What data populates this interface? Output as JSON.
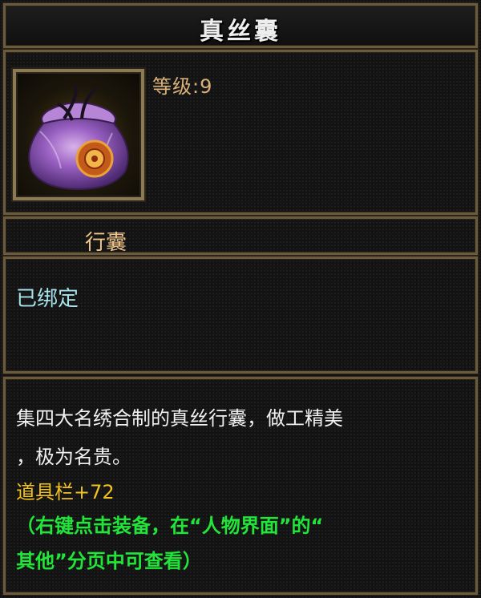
{
  "item": {
    "name": "真丝囊",
    "level_label": "等级",
    "level_sep": ":",
    "level_value": "9",
    "category": "行囊",
    "bind_status": "已绑定",
    "desc_line1": "集四大名绣合制的真丝行囊，做工精美",
    "desc_line2": "，极为名贵。",
    "attr_line": "道具栏+72",
    "hint_line1": "（右键点击装备，在“人物界面”的“",
    "hint_line2": "其他”分页中可查看）"
  },
  "icon": {
    "name": "silk-pouch-icon"
  },
  "colors": {
    "title": "#eeeeee",
    "level": "#d9b27a",
    "category": "#f0c58a",
    "bound": "#a6e3ea",
    "desc": "#f0f0f0",
    "attribute": "#f2c21e",
    "hint": "#22e53a",
    "border": "#6b5b3e"
  }
}
